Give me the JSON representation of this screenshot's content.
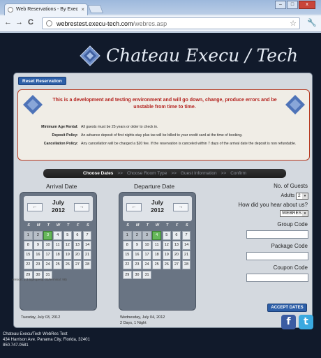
{
  "browser": {
    "tab_title": "Web Reservations - By Exec",
    "tab_close": "×",
    "window_buttons": [
      "–",
      "□",
      "x"
    ],
    "url_host": "webrestest.execu-tech.com",
    "url_path": "/webres.asp",
    "back": "←",
    "forward": "→",
    "reload": "C",
    "star": "☆",
    "wrench": "🔧"
  },
  "header": {
    "logo_text": "Chateau Execu / Tech"
  },
  "reset_button": "Reset Reservation",
  "notice": {
    "message": "This is a development and testing environment and will go down, change, produce errors and be unstable from time to time.",
    "policies": [
      {
        "label": "Minimum Age Rental:",
        "text": "All guests must be 25 years or older to check in."
      },
      {
        "label": "Deposit Policy:",
        "text": "An advance deposit of first nights stay plus tax will be billed to your credit card at the time of booking."
      },
      {
        "label": "Cancellation Policy:",
        "text": "Any cancellation will be charged a $20 fee. If the reservation is canceled within 7 days of the arrival date the deposit is non refundable."
      }
    ]
  },
  "steps": [
    {
      "label": "Choose Dates",
      "active": true
    },
    {
      "label": ">>",
      "active": false
    },
    {
      "label": "Choose Room Type",
      "active": false
    },
    {
      "label": ">>",
      "active": false
    },
    {
      "label": "Guest Information",
      "active": false
    },
    {
      "label": ">>",
      "active": false
    },
    {
      "label": "Confirm",
      "active": false
    }
  ],
  "arrival": {
    "title": "Arrival Date",
    "month": "July",
    "year": "2012",
    "prev": "←",
    "next": "→",
    "selected_text": "Tuesday, July 03, 2012",
    "past_days": [
      1,
      2
    ],
    "selected_day": 3
  },
  "departure": {
    "title": "Departure Date",
    "month": "July",
    "year": "2012",
    "prev": "←",
    "next": "→",
    "selected_text": "Wednesday, July 04, 2012",
    "stay_text": "2 Days, 1 Night",
    "past_days": [
      1,
      2,
      3
    ],
    "selected_day": 4
  },
  "calendar": {
    "weekdays": [
      "S",
      "M",
      "T",
      "W",
      "T",
      "F",
      "S"
    ],
    "days": [
      1,
      2,
      3,
      4,
      5,
      6,
      7,
      8,
      9,
      10,
      11,
      12,
      13,
      14,
      15,
      16,
      17,
      18,
      19,
      20,
      21,
      22,
      23,
      24,
      25,
      26,
      27,
      28,
      29,
      30,
      31
    ]
  },
  "form": {
    "guests_heading": "No. of Guests",
    "adults_label": "Adults",
    "adults_value": "2",
    "hear_label": "How did you hear about us?",
    "hear_value": "WEBRES",
    "group_code_label": "Group Code",
    "group_code_value": "",
    "package_code_label": "Package Code",
    "package_code_value": "",
    "coupon_code_label": "Coupon Code",
    "coupon_code_value": "",
    "accept_button": "ACCEPT DATES",
    "dropdown_arrow": "▾"
  },
  "version_text": "version: 2.3.5(property: 01/terminal: 98)",
  "footer": {
    "line1": "Chateau Execu/Tech WebRes Test",
    "line2": "434 Harrison Ave. Panama City, Florida, 32401",
    "line3": "850.747.0581"
  },
  "social": {
    "facebook": "f",
    "twitter": "t"
  },
  "colors": {
    "page_bg": "#111a2b",
    "accent_blue": "#2d5fa8",
    "notice_red": "#b3201c",
    "selected_green": "#66b85a"
  }
}
